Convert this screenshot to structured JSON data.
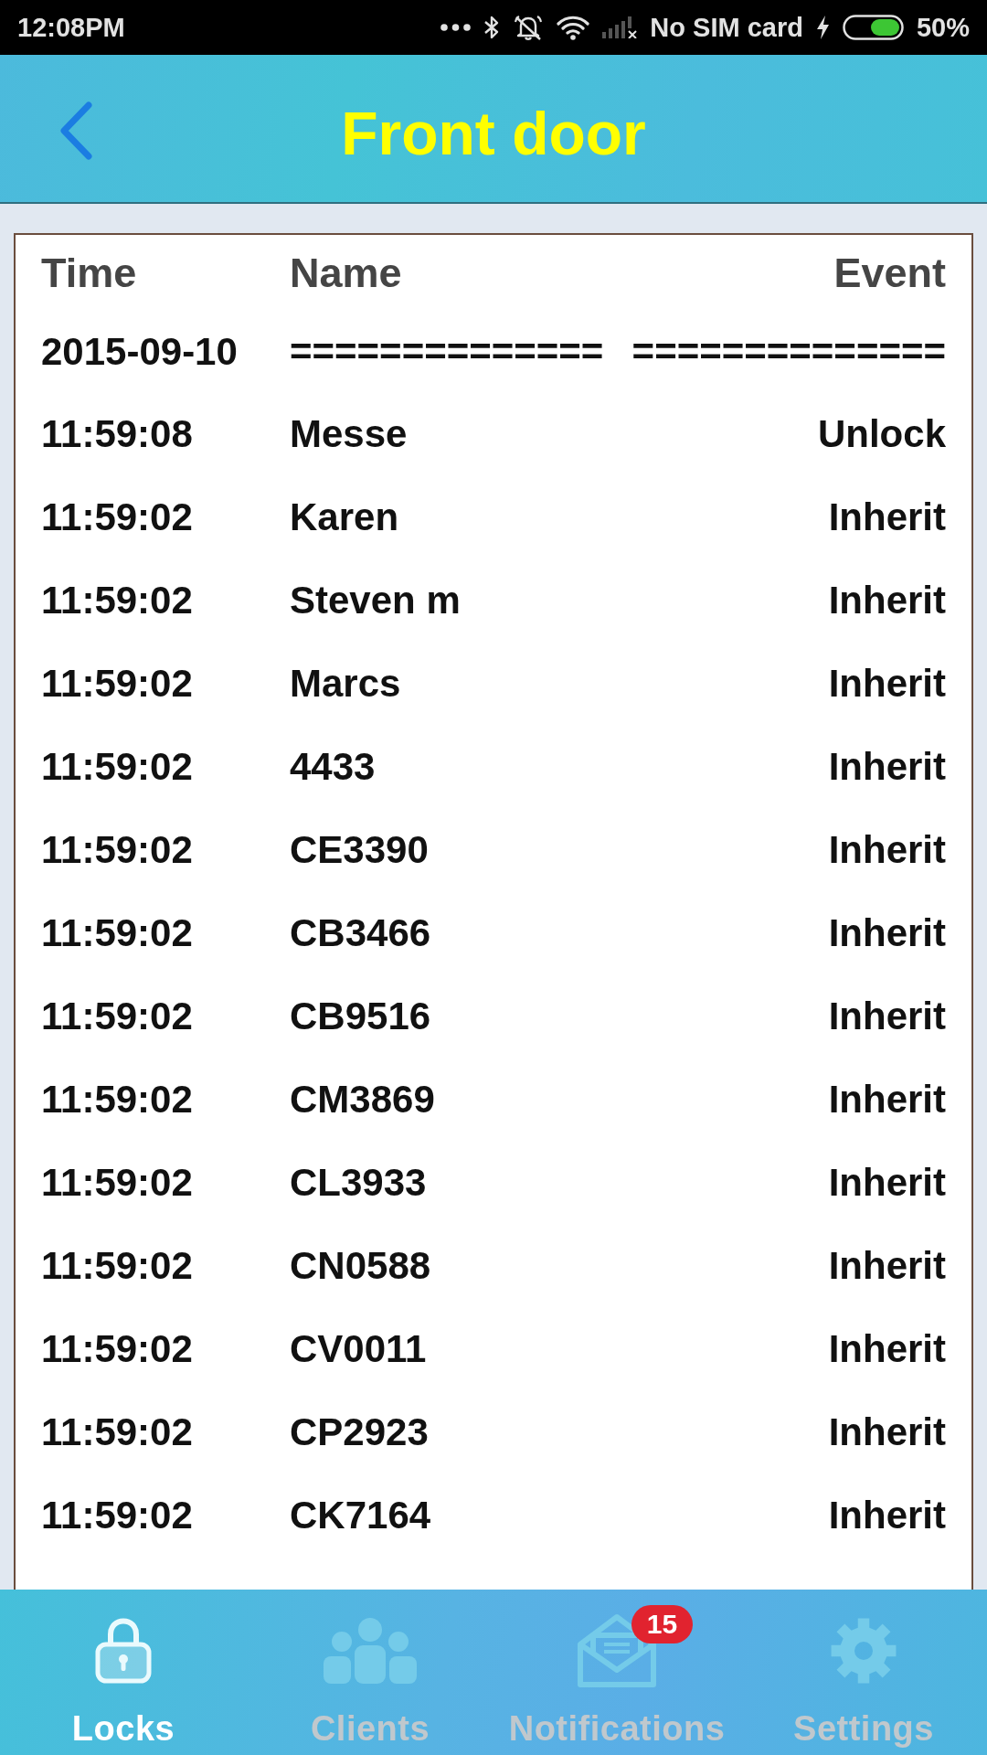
{
  "status_bar": {
    "time": "12:08PM",
    "carrier": "No SIM card",
    "battery": "50%"
  },
  "header": {
    "title": "Front door"
  },
  "table": {
    "columns": [
      "Time",
      "Name",
      "Event"
    ],
    "date_row": {
      "time": "2015-09-10",
      "name": "==============",
      "event": "=============="
    },
    "rows": [
      {
        "time": "11:59:08",
        "name": "Messe",
        "event": "Unlock"
      },
      {
        "time": "11:59:02",
        "name": "Karen",
        "event": "Inherit"
      },
      {
        "time": "11:59:02",
        "name": "Steven m",
        "event": "Inherit"
      },
      {
        "time": "11:59:02",
        "name": "Marcs",
        "event": "Inherit"
      },
      {
        "time": "11:59:02",
        "name": "4433",
        "event": "Inherit"
      },
      {
        "time": "11:59:02",
        "name": "CE3390",
        "event": "Inherit"
      },
      {
        "time": "11:59:02",
        "name": "CB3466",
        "event": "Inherit"
      },
      {
        "time": "11:59:02",
        "name": "CB9516",
        "event": "Inherit"
      },
      {
        "time": "11:59:02",
        "name": "CM3869",
        "event": "Inherit"
      },
      {
        "time": "11:59:02",
        "name": "CL3933",
        "event": "Inherit"
      },
      {
        "time": "11:59:02",
        "name": "CN0588",
        "event": "Inherit"
      },
      {
        "time": "11:59:02",
        "name": "CV0011",
        "event": "Inherit"
      },
      {
        "time": "11:59:02",
        "name": "CP2923",
        "event": "Inherit"
      },
      {
        "time": "11:59:02",
        "name": "CK7164",
        "event": "Inherit"
      }
    ]
  },
  "bottom_nav": {
    "tabs": [
      {
        "kind": "lock",
        "label": "Locks",
        "selected": true
      },
      {
        "kind": "people",
        "label": "Clients",
        "selected": false
      },
      {
        "kind": "mail",
        "label": "Notifications",
        "selected": false,
        "badge": "15"
      },
      {
        "kind": "gear",
        "label": "Settings",
        "selected": false
      }
    ]
  }
}
